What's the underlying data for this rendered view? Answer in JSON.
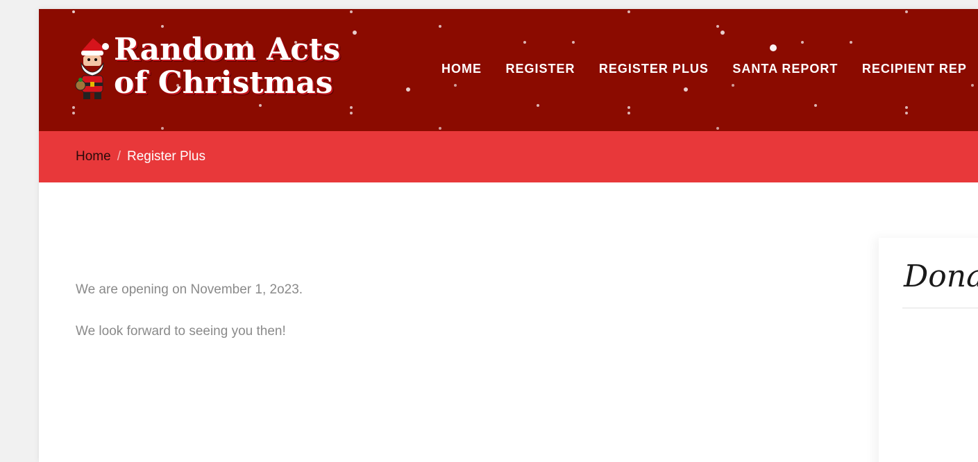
{
  "header": {
    "logo_line1": "Random Acts",
    "logo_line2": "of Christmas",
    "logo_icon": "santa-icon",
    "nav": [
      {
        "label": "HOME"
      },
      {
        "label": "REGISTER"
      },
      {
        "label": "REGISTER PLUS"
      },
      {
        "label": "SANTA REPORT"
      },
      {
        "label": "RECIPIENT REP"
      }
    ]
  },
  "breadcrumb": {
    "home": "Home",
    "separator": "/",
    "current": "Register Plus"
  },
  "main": {
    "paragraphs": [
      "We are opening on November 1, 2o23.",
      "We look forward to seeing you then!"
    ]
  },
  "sidebar": {
    "title": "Donate"
  },
  "colors": {
    "header_bg": "#8b0b00",
    "breadcrumb_bg": "#e8383a",
    "text_muted": "#8a8a8a"
  }
}
